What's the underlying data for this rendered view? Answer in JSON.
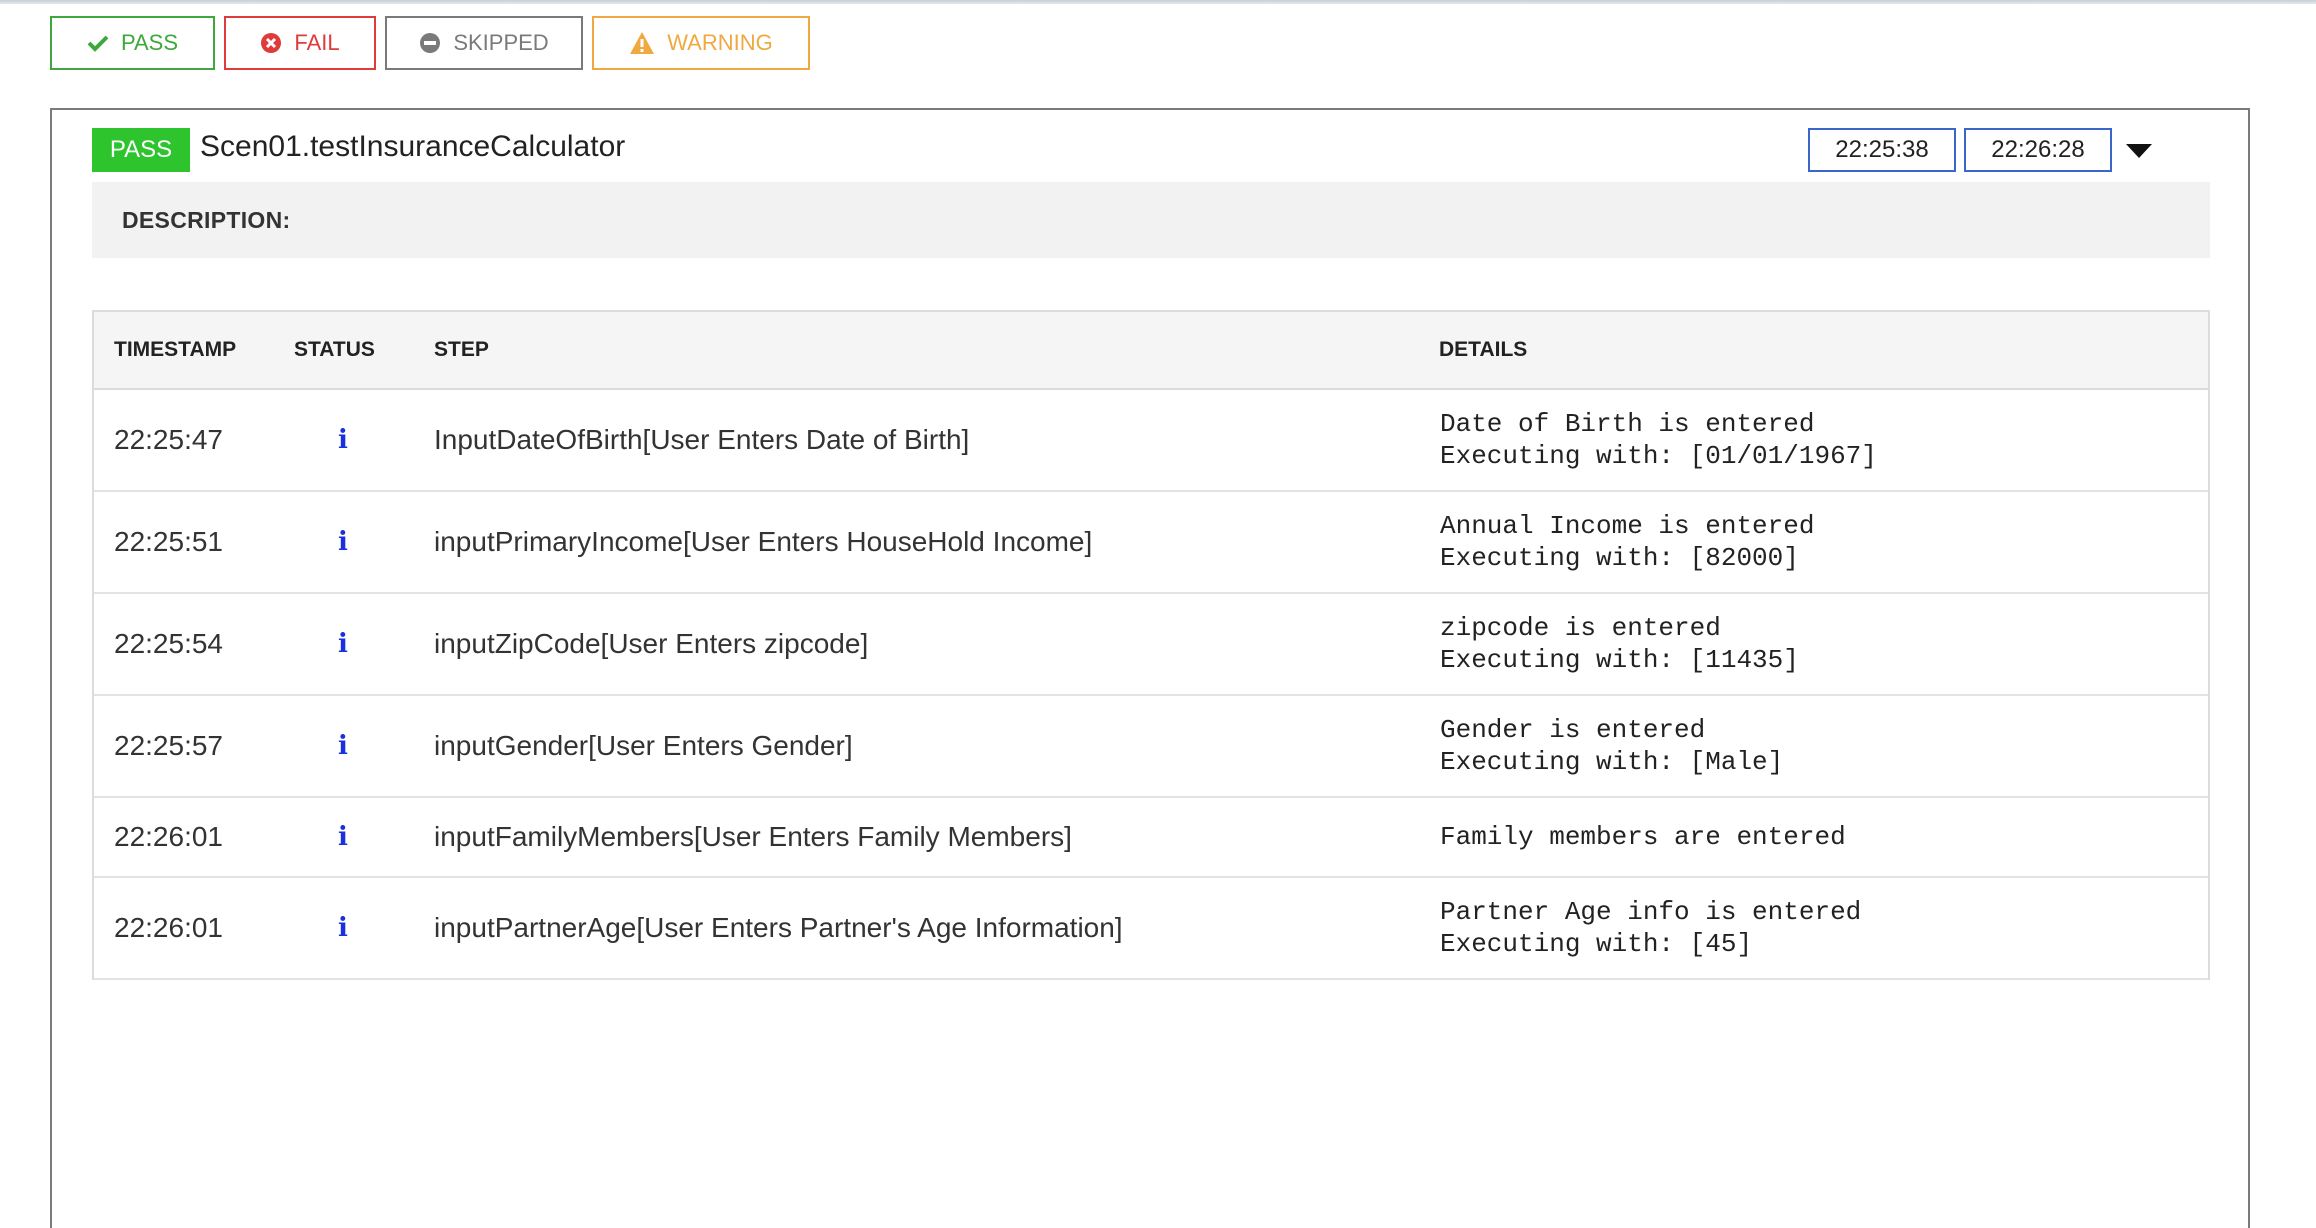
{
  "filters": {
    "pass": "PASS",
    "fail": "FAIL",
    "skipped": "SKIPPED",
    "warning": "WARNING"
  },
  "test": {
    "status": "PASS",
    "name": "Scen01.testInsuranceCalculator",
    "start_time": "22:25:38",
    "end_time": "22:26:28",
    "description_label": "DESCRIPTION:"
  },
  "table": {
    "headers": [
      "TIMESTAMP",
      "STATUS",
      "STEP",
      "DETAILS"
    ],
    "rows": [
      {
        "timestamp": "22:25:47",
        "status_icon": "info-icon",
        "step": "InputDateOfBirth[User Enters Date of Birth]",
        "details_line1": "Date of Birth is entered",
        "details_line2": "Executing with: [01/01/1967]"
      },
      {
        "timestamp": "22:25:51",
        "status_icon": "info-icon",
        "step": "inputPrimaryIncome[User Enters HouseHold Income]",
        "details_line1": "Annual Income is entered",
        "details_line2": "Executing with: [82000]"
      },
      {
        "timestamp": "22:25:54",
        "status_icon": "info-icon",
        "step": "inputZipCode[User Enters zipcode]",
        "details_line1": "zipcode is entered",
        "details_line2": "Executing with: [11435]"
      },
      {
        "timestamp": "22:25:57",
        "status_icon": "info-icon",
        "step": "inputGender[User Enters Gender]",
        "details_line1": "Gender is entered",
        "details_line2": "Executing with: [Male]"
      },
      {
        "timestamp": "22:26:01",
        "status_icon": "info-icon",
        "step": "inputFamilyMembers[User Enters Family Members]",
        "details_line1": "Family members are entered",
        "details_line2": ""
      },
      {
        "timestamp": "22:26:01",
        "status_icon": "info-icon",
        "step": "inputPartnerAge[User Enters Partner's Age Information]",
        "details_line1": "Partner Age info is entered",
        "details_line2": "Executing with: [45]"
      }
    ]
  },
  "colors": {
    "pass": "#3ea83e",
    "pass_badge": "#2dc42d",
    "fail": "#e03b3b",
    "skipped": "#7a7a7a",
    "warning": "#f0a940",
    "info_icon": "#1a2fdd",
    "time_border": "#3a66c9"
  }
}
